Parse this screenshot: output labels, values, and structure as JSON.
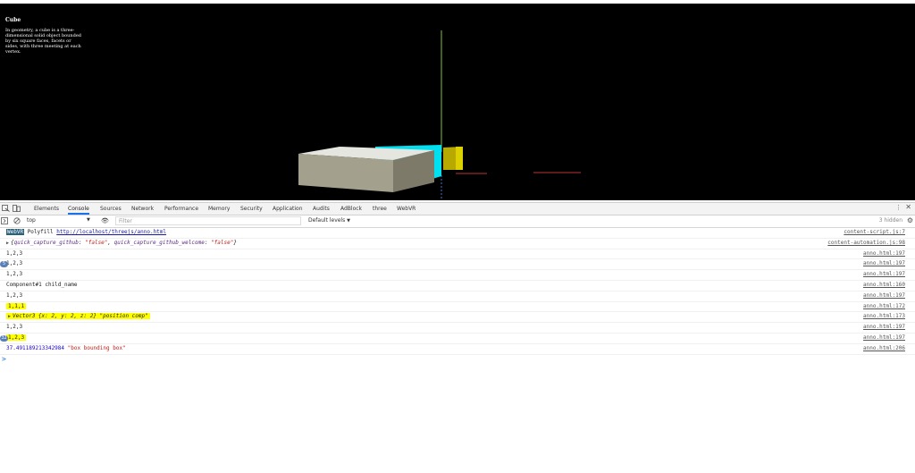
{
  "viewport": {
    "title": "Cube",
    "description": "In geometry, a cube is a three-dimensional solid object bounded by six square faces, facets or sides, with three meeting at each vertex."
  },
  "devtools": {
    "tabs": [
      "Elements",
      "Console",
      "Sources",
      "Network",
      "Performance",
      "Memory",
      "Security",
      "Application",
      "Audits",
      "AdBlock",
      "three",
      "WebVR"
    ],
    "active_tab": "Console",
    "toolbar": {
      "context": "top",
      "filter_placeholder": "Filter",
      "levels": "Default levels",
      "hidden": "3 hidden"
    },
    "console": {
      "row0": {
        "prefix": "WebVR",
        "text": "Polyfill ",
        "link": "http://localhost/threejs/anno.html",
        "source": "content-script.js:7"
      },
      "row1": {
        "open": "{",
        "k1": "quick_capture_github",
        "v1": "\"false\"",
        "k2": "quick_capture_github_welcome",
        "v2": "\"false\"",
        "close": "}",
        "source": "content-automation.js:98"
      },
      "row2": {
        "text": "1,2,3",
        "source": "anno.html:197"
      },
      "row3": {
        "badge": "5",
        "text": "1,2,3",
        "source": "anno.html:197"
      },
      "row4": {
        "text": "1,2,3",
        "source": "anno.html:197"
      },
      "row5": {
        "text": "Component#1 child_name",
        "source": "anno.html:160"
      },
      "row6": {
        "text": "1,2,3",
        "source": "anno.html:197"
      },
      "row7": {
        "text": "1,1,1",
        "source": "anno.html:172"
      },
      "row8": {
        "text": "Vector3 {x: 2, y: 2, z: 2} \"position comp\"",
        "source": "anno.html:173"
      },
      "row9": {
        "text": "1,2,3",
        "source": "anno.html:197"
      },
      "row10": {
        "badge": "32",
        "text": "1,2,3",
        "source": "anno.html:197"
      },
      "row11": {
        "num": "37.491189213342984",
        "str": "\"box bounding box\"",
        "source": "anno.html:206"
      },
      "prompt": ">"
    }
  },
  "colors": {
    "viewport_bg": "#000000",
    "box_top": "#e6e6e0",
    "box_front": "#a3a08e",
    "box_side": "#7d7a6a",
    "cyan_box": "#00e0f0",
    "yellow_box": "#b8a900",
    "highlight": "#ffff00",
    "active_tab": "#1a73e8"
  }
}
